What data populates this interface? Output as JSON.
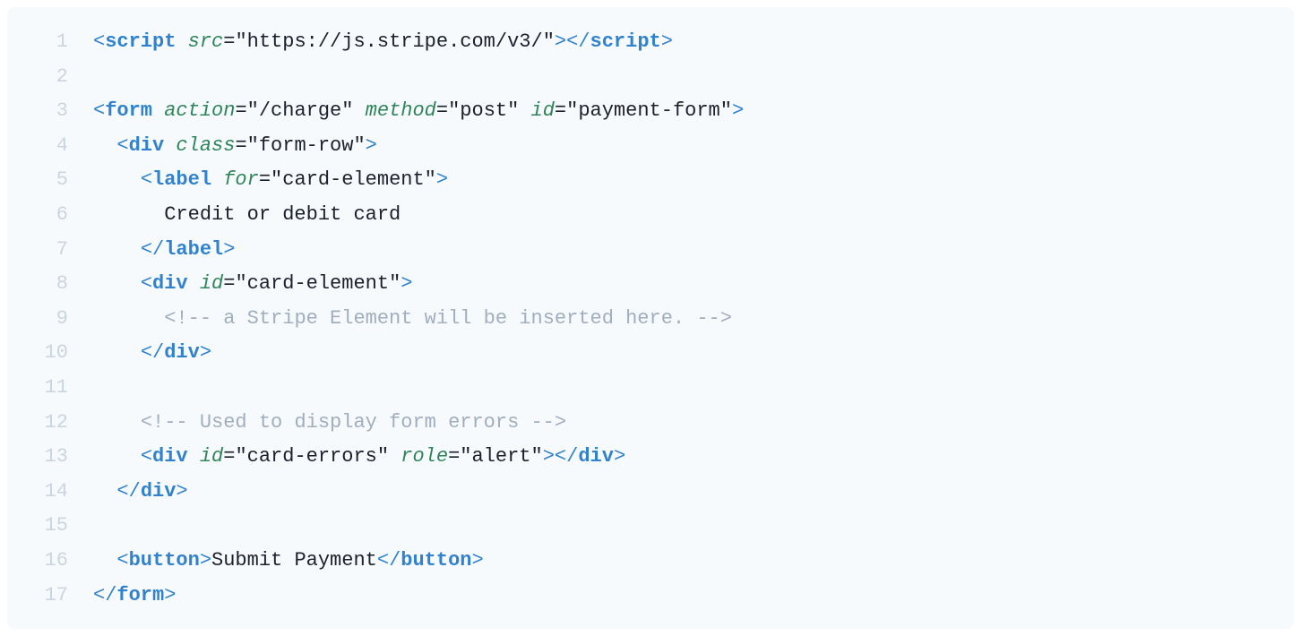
{
  "code": {
    "lines": [
      {
        "num": "1",
        "tokens": [
          {
            "t": "punct",
            "v": "<"
          },
          {
            "t": "tag",
            "v": "script"
          },
          {
            "t": "text",
            "v": " "
          },
          {
            "t": "attr",
            "v": "src"
          },
          {
            "t": "eq",
            "v": "="
          },
          {
            "t": "val",
            "v": "\"https://js.stripe.com/v3/\""
          },
          {
            "t": "punct",
            "v": ">"
          },
          {
            "t": "punct",
            "v": "</"
          },
          {
            "t": "tag",
            "v": "script"
          },
          {
            "t": "punct",
            "v": ">"
          }
        ]
      },
      {
        "num": "2",
        "tokens": []
      },
      {
        "num": "3",
        "tokens": [
          {
            "t": "punct",
            "v": "<"
          },
          {
            "t": "tag",
            "v": "form"
          },
          {
            "t": "text",
            "v": " "
          },
          {
            "t": "attr",
            "v": "action"
          },
          {
            "t": "eq",
            "v": "="
          },
          {
            "t": "val",
            "v": "\"/charge\""
          },
          {
            "t": "text",
            "v": " "
          },
          {
            "t": "attr",
            "v": "method"
          },
          {
            "t": "eq",
            "v": "="
          },
          {
            "t": "val",
            "v": "\"post\""
          },
          {
            "t": "text",
            "v": " "
          },
          {
            "t": "attr",
            "v": "id"
          },
          {
            "t": "eq",
            "v": "="
          },
          {
            "t": "val",
            "v": "\"payment-form\""
          },
          {
            "t": "punct",
            "v": ">"
          }
        ]
      },
      {
        "num": "4",
        "tokens": [
          {
            "t": "text",
            "v": "  "
          },
          {
            "t": "punct",
            "v": "<"
          },
          {
            "t": "tag",
            "v": "div"
          },
          {
            "t": "text",
            "v": " "
          },
          {
            "t": "attr",
            "v": "class"
          },
          {
            "t": "eq",
            "v": "="
          },
          {
            "t": "val",
            "v": "\"form-row\""
          },
          {
            "t": "punct",
            "v": ">"
          }
        ]
      },
      {
        "num": "5",
        "tokens": [
          {
            "t": "text",
            "v": "    "
          },
          {
            "t": "punct",
            "v": "<"
          },
          {
            "t": "tag",
            "v": "label"
          },
          {
            "t": "text",
            "v": " "
          },
          {
            "t": "attr",
            "v": "for"
          },
          {
            "t": "eq",
            "v": "="
          },
          {
            "t": "val",
            "v": "\"card-element\""
          },
          {
            "t": "punct",
            "v": ">"
          }
        ]
      },
      {
        "num": "6",
        "tokens": [
          {
            "t": "text",
            "v": "      Credit or debit card"
          }
        ]
      },
      {
        "num": "7",
        "tokens": [
          {
            "t": "text",
            "v": "    "
          },
          {
            "t": "punct",
            "v": "</"
          },
          {
            "t": "tag",
            "v": "label"
          },
          {
            "t": "punct",
            "v": ">"
          }
        ]
      },
      {
        "num": "8",
        "tokens": [
          {
            "t": "text",
            "v": "    "
          },
          {
            "t": "punct",
            "v": "<"
          },
          {
            "t": "tag",
            "v": "div"
          },
          {
            "t": "text",
            "v": " "
          },
          {
            "t": "attr",
            "v": "id"
          },
          {
            "t": "eq",
            "v": "="
          },
          {
            "t": "val",
            "v": "\"card-element\""
          },
          {
            "t": "punct",
            "v": ">"
          }
        ]
      },
      {
        "num": "9",
        "tokens": [
          {
            "t": "text",
            "v": "      "
          },
          {
            "t": "comment",
            "v": "<!-- a Stripe Element will be inserted here. -->"
          }
        ]
      },
      {
        "num": "10",
        "tokens": [
          {
            "t": "text",
            "v": "    "
          },
          {
            "t": "punct",
            "v": "</"
          },
          {
            "t": "tag",
            "v": "div"
          },
          {
            "t": "punct",
            "v": ">"
          }
        ]
      },
      {
        "num": "11",
        "tokens": []
      },
      {
        "num": "12",
        "tokens": [
          {
            "t": "text",
            "v": "    "
          },
          {
            "t": "comment",
            "v": "<!-- Used to display form errors -->"
          }
        ]
      },
      {
        "num": "13",
        "tokens": [
          {
            "t": "text",
            "v": "    "
          },
          {
            "t": "punct",
            "v": "<"
          },
          {
            "t": "tag",
            "v": "div"
          },
          {
            "t": "text",
            "v": " "
          },
          {
            "t": "attr",
            "v": "id"
          },
          {
            "t": "eq",
            "v": "="
          },
          {
            "t": "val",
            "v": "\"card-errors\""
          },
          {
            "t": "text",
            "v": " "
          },
          {
            "t": "attr",
            "v": "role"
          },
          {
            "t": "eq",
            "v": "="
          },
          {
            "t": "val",
            "v": "\"alert\""
          },
          {
            "t": "punct",
            "v": ">"
          },
          {
            "t": "punct",
            "v": "</"
          },
          {
            "t": "tag",
            "v": "div"
          },
          {
            "t": "punct",
            "v": ">"
          }
        ]
      },
      {
        "num": "14",
        "tokens": [
          {
            "t": "text",
            "v": "  "
          },
          {
            "t": "punct",
            "v": "</"
          },
          {
            "t": "tag",
            "v": "div"
          },
          {
            "t": "punct",
            "v": ">"
          }
        ]
      },
      {
        "num": "15",
        "tokens": []
      },
      {
        "num": "16",
        "tokens": [
          {
            "t": "text",
            "v": "  "
          },
          {
            "t": "punct",
            "v": "<"
          },
          {
            "t": "tag",
            "v": "button"
          },
          {
            "t": "punct",
            "v": ">"
          },
          {
            "t": "text",
            "v": "Submit Payment"
          },
          {
            "t": "punct",
            "v": "</"
          },
          {
            "t": "tag",
            "v": "button"
          },
          {
            "t": "punct",
            "v": ">"
          }
        ]
      },
      {
        "num": "17",
        "tokens": [
          {
            "t": "punct",
            "v": "</"
          },
          {
            "t": "tag",
            "v": "form"
          },
          {
            "t": "punct",
            "v": ">"
          }
        ]
      }
    ]
  }
}
